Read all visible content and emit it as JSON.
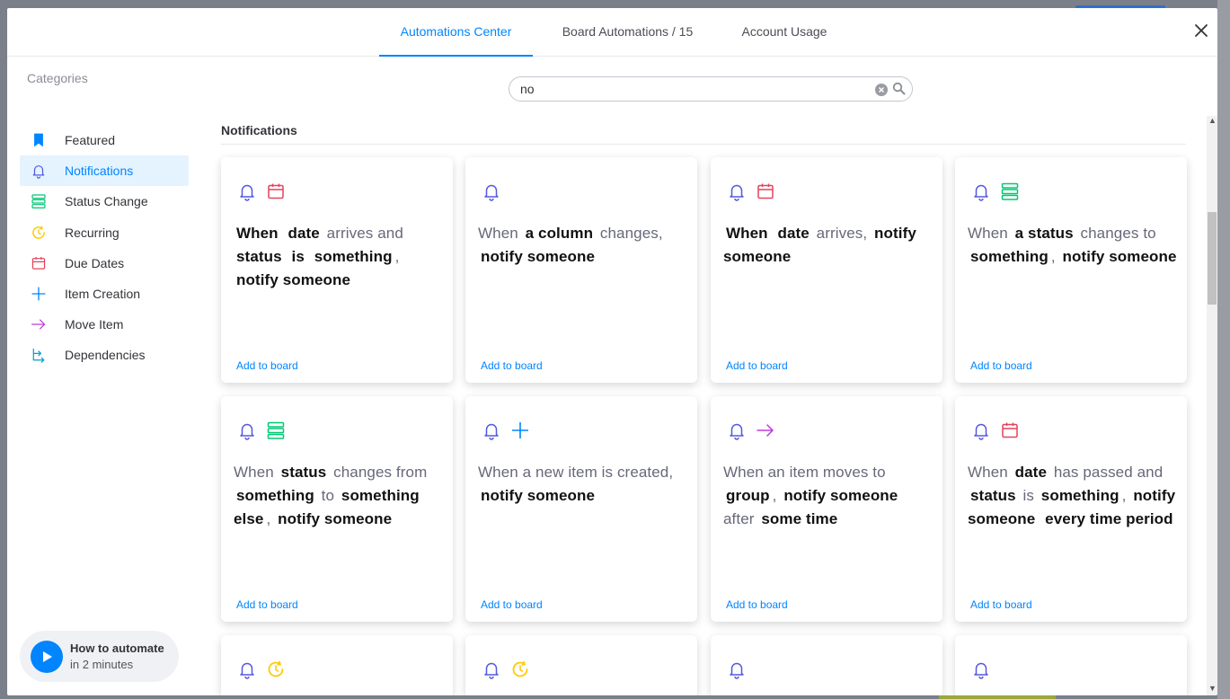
{
  "tabs": [
    {
      "label": "Automations Center",
      "active": true
    },
    {
      "label": "Board Automations / 15",
      "active": false
    },
    {
      "label": "Account Usage",
      "active": false
    }
  ],
  "sidebar": {
    "title": "Categories",
    "items": [
      {
        "label": "Featured",
        "icon": "bookmark-icon",
        "color": "#0085ff"
      },
      {
        "label": "Notifications",
        "icon": "bell-icon",
        "color": "#5559df",
        "active": true
      },
      {
        "label": "Status Change",
        "icon": "status-icon",
        "color": "#00c875"
      },
      {
        "label": "Recurring",
        "icon": "clock-icon",
        "color": "#ffcb00"
      },
      {
        "label": "Due Dates",
        "icon": "calendar-icon",
        "color": "#e2445c"
      },
      {
        "label": "Item Creation",
        "icon": "plus-icon",
        "color": "#0085ff"
      },
      {
        "label": "Move Item",
        "icon": "arrow-icon",
        "color": "#bb3ddb"
      },
      {
        "label": "Dependencies",
        "icon": "dependency-icon",
        "color": "#00a0d2"
      }
    ]
  },
  "howto": {
    "line1": "How to automate",
    "line2": "in 2 minutes"
  },
  "search": {
    "value": "no"
  },
  "section": {
    "title": "Notifications"
  },
  "cards": [
    {
      "icons": [
        "bell-icon",
        "calendar-icon"
      ],
      "segments": [
        [
          "b",
          "When"
        ],
        [
          "t",
          " "
        ],
        [
          "b",
          "date"
        ],
        [
          "t",
          " arrives and "
        ],
        [
          "b",
          "status"
        ],
        [
          "t",
          " "
        ],
        [
          "b",
          "is"
        ],
        [
          "t",
          " "
        ],
        [
          "b",
          "something"
        ],
        [
          "t",
          ", "
        ],
        [
          "b",
          "notify someone"
        ]
      ],
      "add": "Add to board"
    },
    {
      "icons": [
        "bell-icon"
      ],
      "segments": [
        [
          "t",
          "When "
        ],
        [
          "b",
          "a column"
        ],
        [
          "t",
          " changes, "
        ],
        [
          "b",
          "notify someone"
        ]
      ],
      "add": "Add to board"
    },
    {
      "icons": [
        "bell-icon",
        "calendar-icon"
      ],
      "segments": [
        [
          "b",
          "When"
        ],
        [
          "t",
          " "
        ],
        [
          "b",
          "date"
        ],
        [
          "t",
          " arrives, "
        ],
        [
          "b",
          "notify someone"
        ]
      ],
      "add": "Add to board"
    },
    {
      "icons": [
        "bell-icon",
        "status-icon"
      ],
      "segments": [
        [
          "t",
          "When "
        ],
        [
          "b",
          "a status"
        ],
        [
          "t",
          " changes to "
        ],
        [
          "b",
          "something"
        ],
        [
          "t",
          ", "
        ],
        [
          "b",
          "notify someone"
        ]
      ],
      "add": "Add to board"
    },
    {
      "icons": [
        "bell-icon",
        "status-icon"
      ],
      "segments": [
        [
          "t",
          "When "
        ],
        [
          "b",
          "status"
        ],
        [
          "t",
          " changes from "
        ],
        [
          "b",
          "something"
        ],
        [
          "t",
          " to "
        ],
        [
          "b",
          "something else"
        ],
        [
          "t",
          ", "
        ],
        [
          "b",
          "notify someone"
        ]
      ],
      "add": "Add to board"
    },
    {
      "icons": [
        "bell-icon",
        "plus-icon"
      ],
      "segments": [
        [
          "t",
          "When a new item is created, "
        ],
        [
          "b",
          "notify someone"
        ]
      ],
      "add": "Add to board"
    },
    {
      "icons": [
        "bell-icon",
        "arrow-icon"
      ],
      "segments": [
        [
          "t",
          "When an item moves to "
        ],
        [
          "b",
          "group"
        ],
        [
          "t",
          ", "
        ],
        [
          "b",
          "notify someone"
        ],
        [
          "t",
          " after "
        ],
        [
          "b",
          "some time"
        ]
      ],
      "add": "Add to board"
    },
    {
      "icons": [
        "bell-icon",
        "calendar-icon"
      ],
      "segments": [
        [
          "t",
          "When "
        ],
        [
          "b",
          "date"
        ],
        [
          "t",
          " has passed and "
        ],
        [
          "b",
          "status"
        ],
        [
          "t",
          " is "
        ],
        [
          "b",
          "something"
        ],
        [
          "t",
          ", "
        ],
        [
          "b",
          "notify someone"
        ],
        [
          "t",
          " "
        ],
        [
          "b",
          "every time period"
        ]
      ],
      "add": "Add to board"
    },
    {
      "icons": [
        "bell-icon",
        "clock-icon"
      ],
      "segments": [],
      "add": ""
    },
    {
      "icons": [
        "bell-icon",
        "clock-icon"
      ],
      "segments": [],
      "add": ""
    },
    {
      "icons": [
        "bell-icon"
      ],
      "segments": [],
      "add": ""
    },
    {
      "icons": [
        "bell-icon"
      ],
      "segments": [],
      "add": ""
    }
  ],
  "colors": {
    "accent": "#0085ff",
    "bell": "#5559df",
    "calendar": "#e2445c",
    "status": "#00c875",
    "clock": "#ffcb00",
    "plus": "#0085ff",
    "arrow": "#bb3ddb",
    "dependency": "#00a0d2"
  }
}
